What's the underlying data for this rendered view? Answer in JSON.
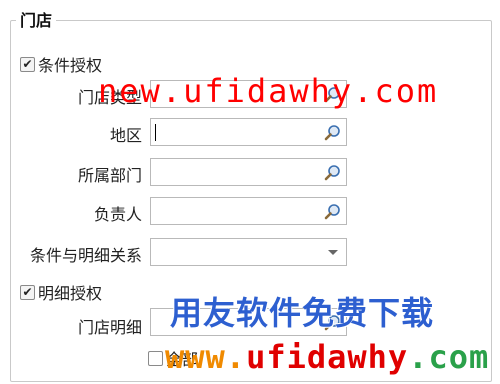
{
  "group": {
    "title": "门店"
  },
  "condition_auth": {
    "label": "条件授权",
    "checked": true,
    "check_glyph": "✔"
  },
  "fields": {
    "store_type": {
      "label": "门店类型",
      "value": ""
    },
    "region": {
      "label": "地区",
      "value": ""
    },
    "department": {
      "label": "所属部门",
      "value": ""
    },
    "owner": {
      "label": "负责人",
      "value": ""
    },
    "relation": {
      "label": "条件与明细关系",
      "value": ""
    },
    "store_detail": {
      "label": "门店明细",
      "value": ""
    }
  },
  "detail_auth": {
    "label": "明细授权",
    "checked": true,
    "check_glyph": "✔"
  },
  "all": {
    "label": "全部",
    "checked": false
  },
  "watermarks": {
    "top": "new.ufidawhy.com",
    "middle": "用友软件免费下载",
    "bottom_w": "www.",
    "bottom_u": "ufidawhy",
    "bottom_c": ".com"
  },
  "icons": {
    "lookup": "magnifier-icon",
    "dropdown": "chevron-down-icon"
  }
}
